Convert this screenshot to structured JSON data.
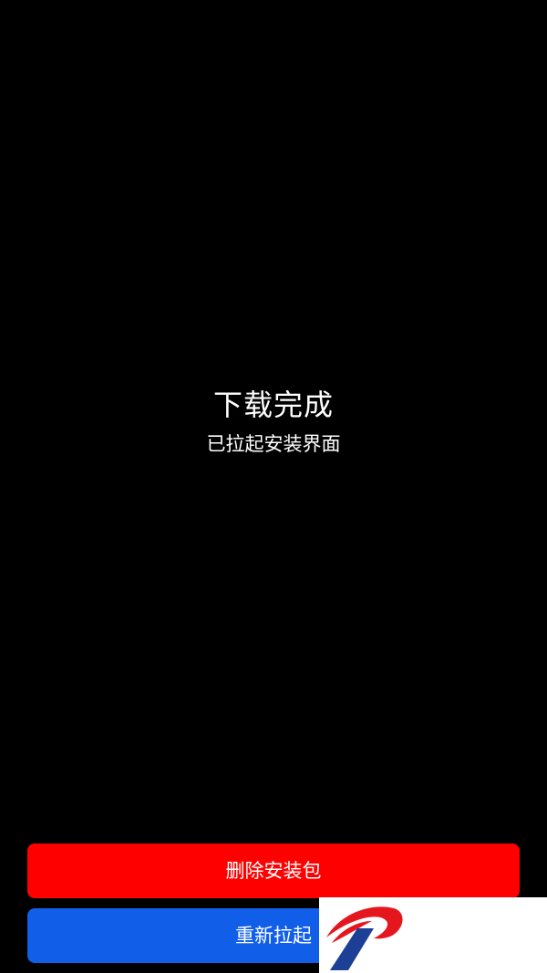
{
  "status": {
    "title": "下载完成",
    "subtitle": "已拉起安装界面"
  },
  "actions": {
    "delete_label": "删除安装包",
    "relaunch_label": "重新拉起"
  },
  "colors": {
    "background": "#000000",
    "text": "#ffffff",
    "delete_button": "#ff0000",
    "relaunch_button": "#115ee8",
    "logo_red": "#e5161e",
    "logo_blue": "#1d3f95"
  },
  "icons": {
    "watermark_logo": "p-logo-icon"
  }
}
